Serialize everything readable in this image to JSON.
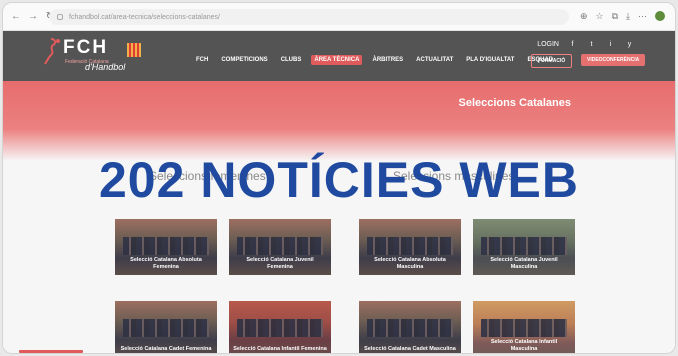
{
  "browser": {
    "url": "fchandbol.cat/area-tecnica/seleccions-catalanes/",
    "nav": [
      "←",
      "→",
      "↻",
      "⌂"
    ],
    "right_icons": [
      "⊕",
      "☆",
      "⧉",
      "⤓",
      "⋯"
    ]
  },
  "site": {
    "logo": {
      "brand": "FCH",
      "sub": "Federació Catalana",
      "hand": "d'Handbol"
    },
    "topright": {
      "login": "LOGIN",
      "social": [
        "f",
        "t",
        "i",
        "y"
      ]
    },
    "menu": [
      "FCH",
      "COMPETICIONS",
      "CLUBS",
      "ÀREA TÈCNICA",
      "ÀRBITRES",
      "ACTUALITAT",
      "PLA D'IGUALTAT",
      "ESQUAD"
    ],
    "active_menu": "ÀREA TÈCNICA",
    "button_formacio": "FORMACIÓ",
    "button_video": "VIDEOCONFERÈNCIA",
    "banner_title": "Seleccions Catalanes",
    "section_left": "Seleccions femenines",
    "section_right": "Seleccions masculines",
    "tiles": [
      {
        "label": "Selecció Catalana Absoluta Femenina",
        "theme": "plain"
      },
      {
        "label": "Selecció Catalana Juvenil Femenina",
        "theme": "plain"
      },
      {
        "label": "Selecció Catalana Absoluta Masculina",
        "theme": "plain"
      },
      {
        "label": "Selecció Catalana Juvenil Masculina",
        "theme": "green"
      },
      {
        "label": "Selecció Catalana Cadet Femenina",
        "theme": "plain"
      },
      {
        "label": "Selecció Catalana Infantil Femenina",
        "theme": "red"
      },
      {
        "label": "Selecció Catalana Cadet Masculina",
        "theme": "plain"
      },
      {
        "label": "Selecció Catalana Infantil Masculina",
        "theme": "orange"
      }
    ]
  },
  "overlay": {
    "text": "202 NOTÍCIES WEB"
  },
  "colors": {
    "accent": "#e05b5b",
    "header": "#545454",
    "overlay": "#1f4aa0"
  }
}
